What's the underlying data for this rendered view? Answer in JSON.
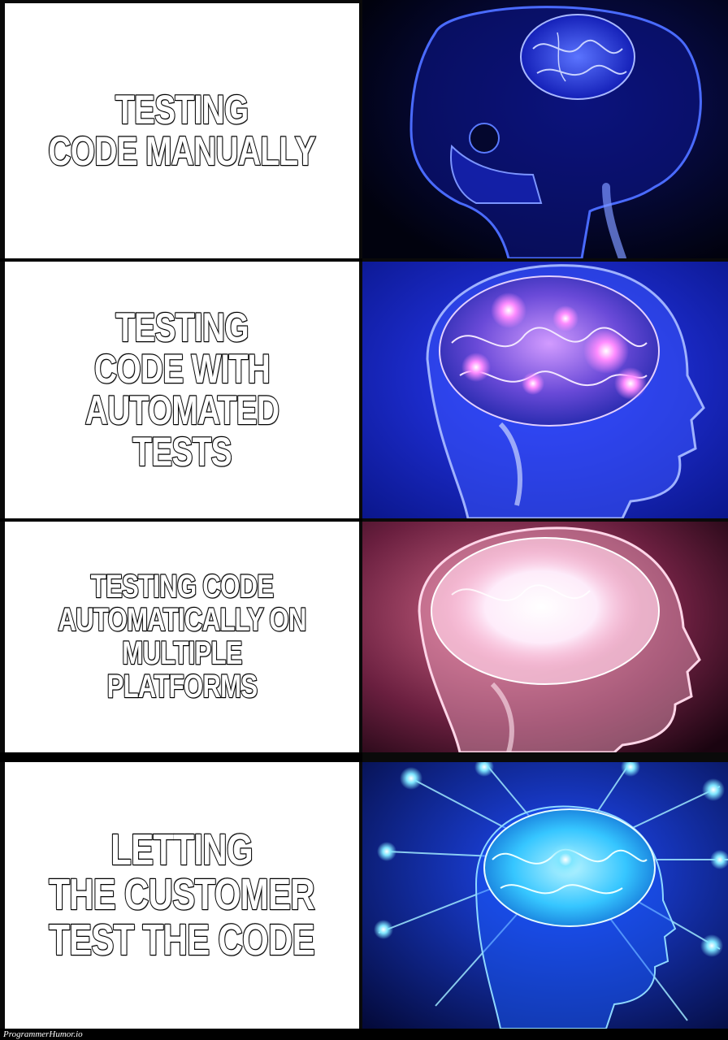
{
  "panels": [
    {
      "caption": "TESTING\nCODE MANUALLY",
      "brain_level": 1
    },
    {
      "caption": "TESTING\nCODE WITH\nAUTOMATED TESTS",
      "brain_level": 2
    },
    {
      "caption": "TESTING CODE\nAUTOMATICALLY ON\nMULTIPLE PLATFORMS",
      "brain_level": 3
    },
    {
      "caption": "LETTING\nTHE CUSTOMER\nTEST THE CODE",
      "brain_level": 4
    }
  ],
  "footer": {
    "watermark": "ProgrammerHumor.io"
  },
  "colors": {
    "panel1_bg": "#02041a",
    "panel1_glow": "#2a3cff",
    "panel2_bg": "#0a1a9a",
    "panel2_glow": "#ff66ff",
    "panel3_bg": "#5a1a3a",
    "panel3_glow": "#ffffff",
    "panel4_bg": "#06124a",
    "panel4_glow": "#33ccff"
  }
}
